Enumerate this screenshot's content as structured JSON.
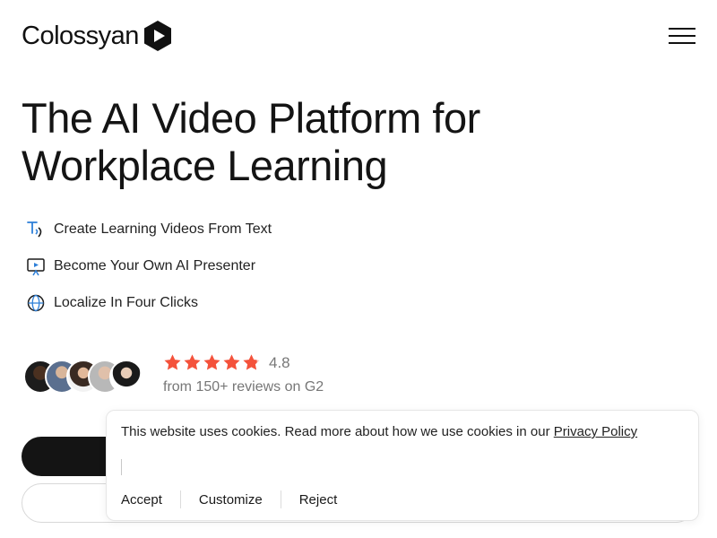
{
  "header": {
    "logo_text": "Colossyan",
    "menu_icon": "hamburger-menu-icon"
  },
  "hero": {
    "title": "The AI Video Platform for Workplace Learning"
  },
  "features": [
    {
      "label": "Create Learning Videos From Text",
      "icon": "text-to-speech-icon"
    },
    {
      "label": "Become Your Own AI Presenter",
      "icon": "presenter-screen-icon"
    },
    {
      "label": "Localize In Four Clicks",
      "icon": "globe-icon"
    }
  ],
  "rating": {
    "score": "4.8",
    "stars": 4.8,
    "reviews_text": "from 150+ reviews on G2",
    "avatar_count": 5
  },
  "cookie_banner": {
    "text": "This website uses cookies. Read more about how we use cookies in our",
    "link_text": "Privacy Policy",
    "accept": "Accept",
    "customize": "Customize",
    "reject": "Reject"
  },
  "colors": {
    "star": "#f4523b",
    "accent_icon": "#2d7fd8",
    "primary_button": "#141414"
  }
}
